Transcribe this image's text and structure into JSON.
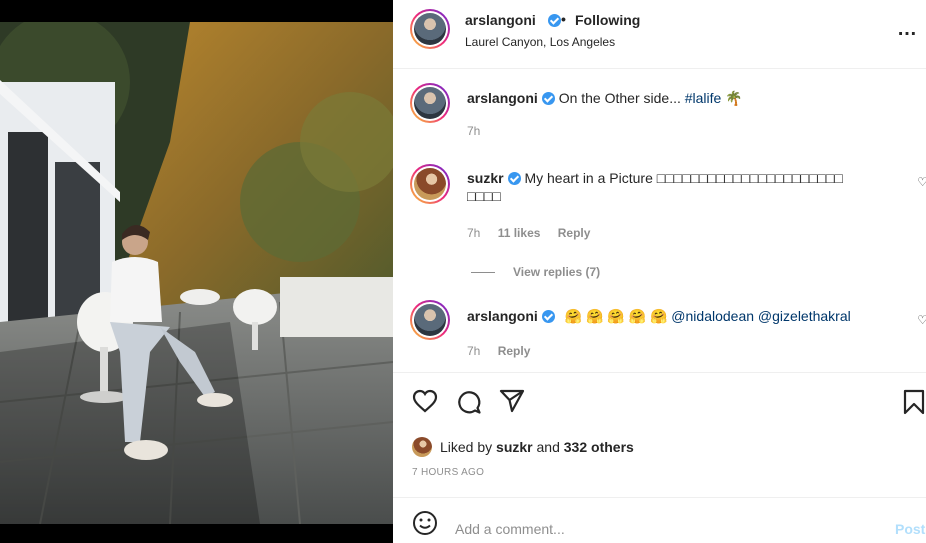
{
  "post": {
    "author": "arslangoni",
    "separator": "•",
    "follow_status": "Following",
    "location": "Laurel Canyon, Los Angeles",
    "more_icon": "…"
  },
  "caption": {
    "username": "arslangoni",
    "text": "On the Other side...",
    "hashtag": "#lalife",
    "emoji": "🌴",
    "time": "7h"
  },
  "comments": [
    {
      "username": "suzkr",
      "text": "My heart in a Picture ",
      "text_tail": "□□□□□□□□□□□□□□□□□□□□□□",
      "text_line2": "□□□□",
      "time": "7h",
      "likes": "11 likes",
      "reply": "Reply",
      "heart": "♡"
    },
    {
      "username": "arslangoni",
      "emojis": "🤗 🤗 🤗 🤗 🤗",
      "mention1": "@nidalodean",
      "mention2": "@gizelethakral",
      "time": "7h",
      "reply": "Reply",
      "heart": "♡"
    }
  ],
  "view_replies": "View replies (7)",
  "likes": {
    "prefix": "Liked by",
    "user": "suzkr",
    "middle": "and",
    "others": "332 others"
  },
  "timestamp": "7 HOURS AGO",
  "add_comment": {
    "placeholder": "Add a comment...",
    "post_label": "Post"
  },
  "icons": {
    "like": "heart-icon",
    "comment": "comment-icon",
    "share": "share-icon",
    "save": "bookmark-icon",
    "emoji": "emoji-icon"
  }
}
